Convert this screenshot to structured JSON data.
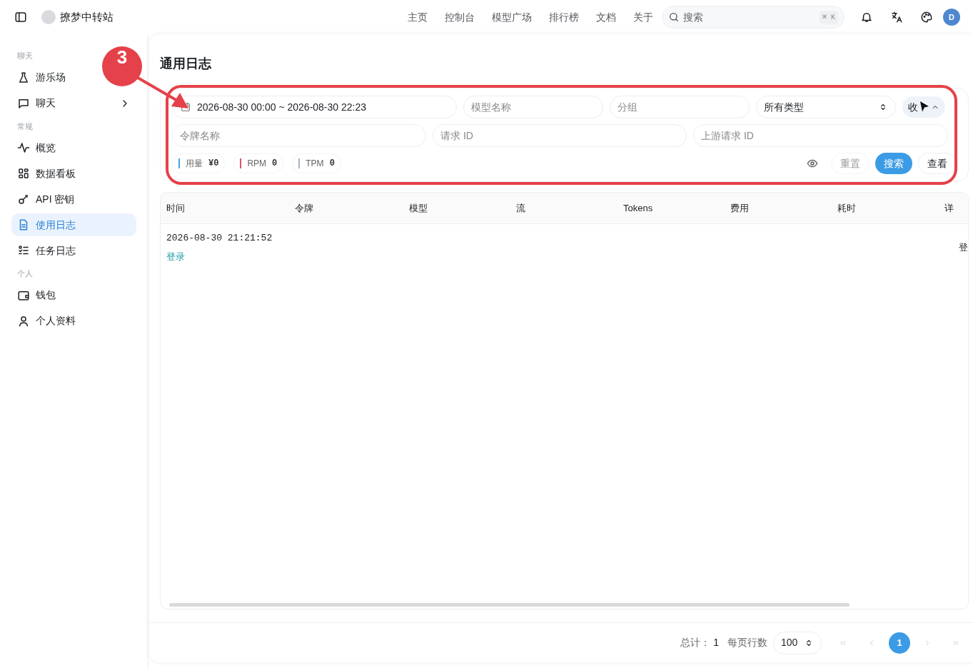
{
  "header": {
    "site_name": "撩梦中转站",
    "nav": [
      {
        "label": "主页"
      },
      {
        "label": "控制台"
      },
      {
        "label": "模型广场"
      },
      {
        "label": "排行榜"
      },
      {
        "label": "文档"
      },
      {
        "label": "关于"
      }
    ],
    "search": {
      "placeholder": "搜索",
      "shortcut": "⌘ K"
    },
    "avatar": "D"
  },
  "sidebar": {
    "sections": [
      {
        "label": "聊天",
        "items": [
          {
            "label": "游乐场",
            "selected": false
          },
          {
            "label": "聊天",
            "selected": false,
            "expanded": false
          }
        ]
      },
      {
        "label": "常规",
        "items": [
          {
            "label": "概览",
            "selected": false
          },
          {
            "label": "数据看板",
            "selected": false
          },
          {
            "label": "API 密钥",
            "selected": false
          },
          {
            "label": "使用日志",
            "selected": true
          },
          {
            "label": "任务日志",
            "selected": false
          }
        ]
      },
      {
        "label": "个人",
        "items": [
          {
            "label": "钱包",
            "selected": false
          },
          {
            "label": "个人资料",
            "selected": false
          }
        ]
      }
    ]
  },
  "page_title": "通用日志",
  "filters": {
    "date_range": "2026-08-30 00:00 ~ 2026-08-30 22:23",
    "model_placeholder": "模型名称",
    "group_placeholder": "分组",
    "type_select": "所有类型",
    "collapse_button": "收",
    "token_placeholder": "令牌名称",
    "request_id_placeholder": "请求 ID",
    "upstream_id_placeholder": "上游请求 ID",
    "stats": [
      {
        "label": "用量",
        "value": "¥0",
        "color": "#4aa3df"
      },
      {
        "label": "RPM",
        "value": "0",
        "color": "#e0526b"
      },
      {
        "label": "TPM",
        "value": "0",
        "color": "#a9b4c6"
      }
    ],
    "buttons": {
      "reset": "重置",
      "search": "搜索",
      "view": "查看"
    }
  },
  "table": {
    "columns": [
      "时间",
      "令牌",
      "模型",
      "流",
      "Tokens",
      "费用",
      "耗时",
      "详"
    ],
    "rows": [
      {
        "time": "2026-08-30 21:21:52",
        "type": "登录",
        "detail": "登"
      }
    ]
  },
  "pagination": {
    "total_label": "总计：",
    "total": "1",
    "per_page_label": "每页行数",
    "per_page": "100",
    "pages": [
      {
        "label": "1",
        "selected": true
      }
    ]
  },
  "annotation": {
    "label": "3"
  }
}
